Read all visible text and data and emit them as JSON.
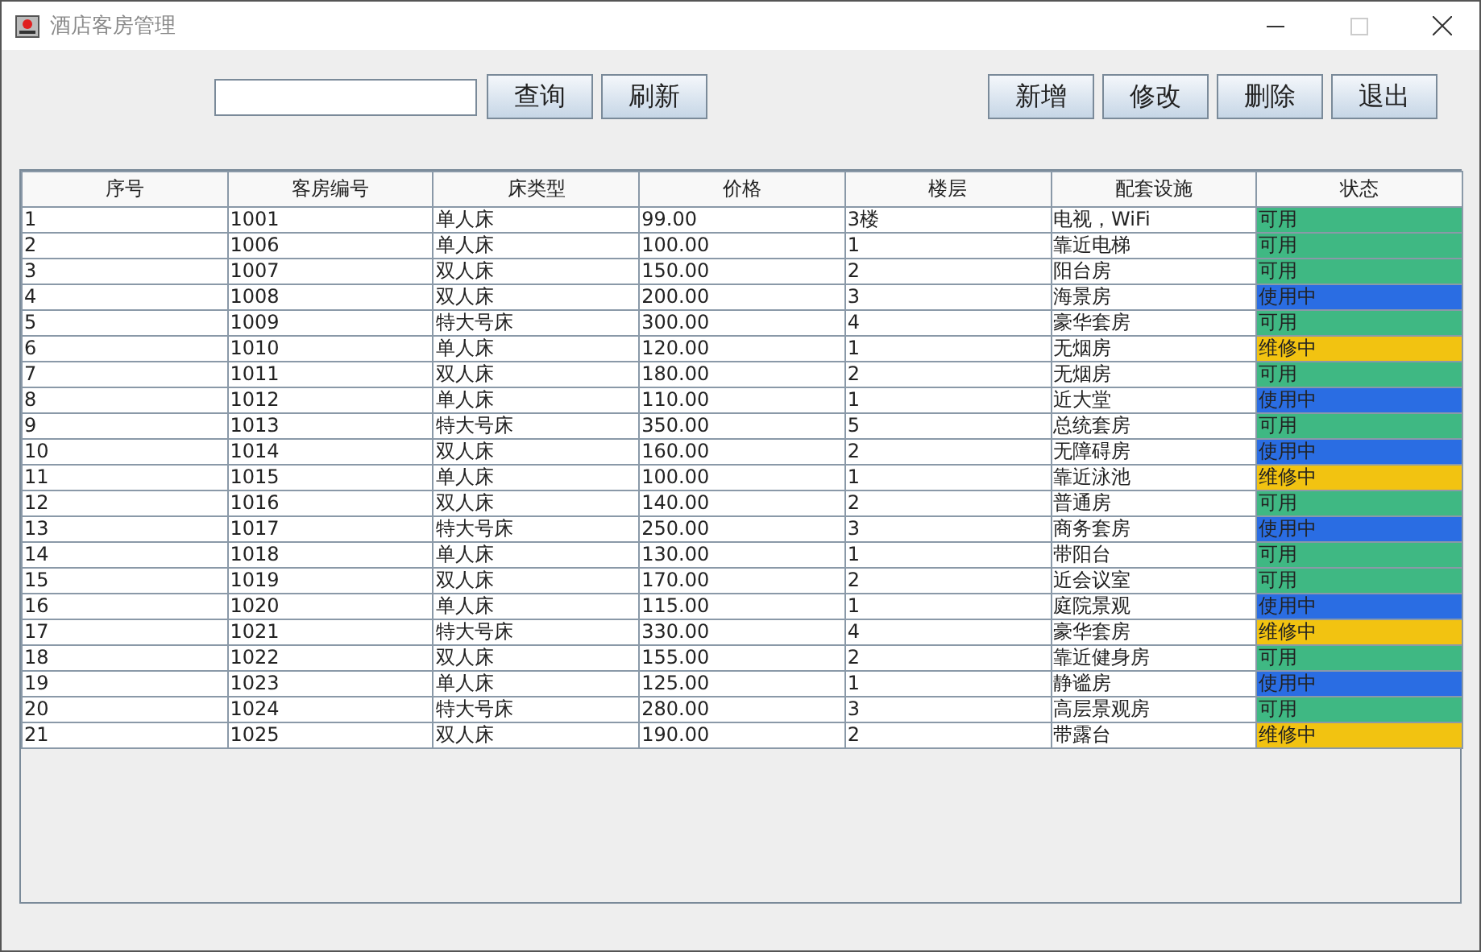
{
  "window": {
    "title": "酒店客房管理"
  },
  "toolbar": {
    "left_buttons": [
      "查询",
      "刷新"
    ],
    "right_buttons": [
      "新增",
      "修改",
      "删除",
      "退出"
    ]
  },
  "table": {
    "columns": [
      "序号",
      "客房编号",
      "床类型",
      "价格",
      "楼层",
      "配套设施",
      "状态"
    ],
    "rows": [
      {
        "cells": [
          "1",
          "1001",
          "单人床",
          "99.00",
          "3楼",
          "电视，WiFi"
        ],
        "status": {
          "text": "可用",
          "color": "#3fb883"
        }
      },
      {
        "cells": [
          "2",
          "1006",
          "单人床",
          "100.00",
          "1",
          "靠近电梯"
        ],
        "status": {
          "text": "可用",
          "color": "#3fb883"
        }
      },
      {
        "cells": [
          "3",
          "1007",
          "双人床",
          "150.00",
          "2",
          "阳台房"
        ],
        "status": {
          "text": "可用",
          "color": "#3fb883"
        }
      },
      {
        "cells": [
          "4",
          "1008",
          "双人床",
          "200.00",
          "3",
          "海景房"
        ],
        "status": {
          "text": "使用中",
          "color": "#2a6de3"
        }
      },
      {
        "cells": [
          "5",
          "1009",
          "特大号床",
          "300.00",
          "4",
          "豪华套房"
        ],
        "status": {
          "text": "可用",
          "color": "#3fb883"
        }
      },
      {
        "cells": [
          "6",
          "1010",
          "单人床",
          "120.00",
          "1",
          "无烟房"
        ],
        "status": {
          "text": "维修中",
          "color": "#f2c311"
        }
      },
      {
        "cells": [
          "7",
          "1011",
          "双人床",
          "180.00",
          "2",
          "无烟房"
        ],
        "status": {
          "text": "可用",
          "color": "#3fb883"
        }
      },
      {
        "cells": [
          "8",
          "1012",
          "单人床",
          "110.00",
          "1",
          "近大堂"
        ],
        "status": {
          "text": "使用中",
          "color": "#2a6de3"
        }
      },
      {
        "cells": [
          "9",
          "1013",
          "特大号床",
          "350.00",
          "5",
          "总统套房"
        ],
        "status": {
          "text": "可用",
          "color": "#3fb883"
        }
      },
      {
        "cells": [
          "10",
          "1014",
          "双人床",
          "160.00",
          "2",
          "无障碍房"
        ],
        "status": {
          "text": "使用中",
          "color": "#2a6de3"
        }
      },
      {
        "cells": [
          "11",
          "1015",
          "单人床",
          "100.00",
          "1",
          "靠近泳池"
        ],
        "status": {
          "text": "维修中",
          "color": "#f2c311"
        }
      },
      {
        "cells": [
          "12",
          "1016",
          "双人床",
          "140.00",
          "2",
          "普通房"
        ],
        "status": {
          "text": "可用",
          "color": "#3fb883"
        }
      },
      {
        "cells": [
          "13",
          "1017",
          "特大号床",
          "250.00",
          "3",
          "商务套房"
        ],
        "status": {
          "text": "使用中",
          "color": "#2a6de3"
        }
      },
      {
        "cells": [
          "14",
          "1018",
          "单人床",
          "130.00",
          "1",
          "带阳台"
        ],
        "status": {
          "text": "可用",
          "color": "#3fb883"
        }
      },
      {
        "cells": [
          "15",
          "1019",
          "双人床",
          "170.00",
          "2",
          "近会议室"
        ],
        "status": {
          "text": "可用",
          "color": "#3fb883"
        }
      },
      {
        "cells": [
          "16",
          "1020",
          "单人床",
          "115.00",
          "1",
          "庭院景观"
        ],
        "status": {
          "text": "使用中",
          "color": "#2a6de3"
        }
      },
      {
        "cells": [
          "17",
          "1021",
          "特大号床",
          "330.00",
          "4",
          "豪华套房"
        ],
        "status": {
          "text": "维修中",
          "color": "#f2c311"
        }
      },
      {
        "cells": [
          "18",
          "1022",
          "双人床",
          "155.00",
          "2",
          "靠近健身房"
        ],
        "status": {
          "text": "可用",
          "color": "#3fb883"
        }
      },
      {
        "cells": [
          "19",
          "1023",
          "单人床",
          "125.00",
          "1",
          "静谧房"
        ],
        "status": {
          "text": "使用中",
          "color": "#2a6de3"
        }
      },
      {
        "cells": [
          "20",
          "1024",
          "特大号床",
          "280.00",
          "3",
          "高层景观房"
        ],
        "status": {
          "text": "可用",
          "color": "#3fb883"
        }
      },
      {
        "cells": [
          "21",
          "1025",
          "双人床",
          "190.00",
          "2",
          "带露台"
        ],
        "status": {
          "text": "维修中",
          "color": "#f2c311"
        }
      }
    ]
  }
}
